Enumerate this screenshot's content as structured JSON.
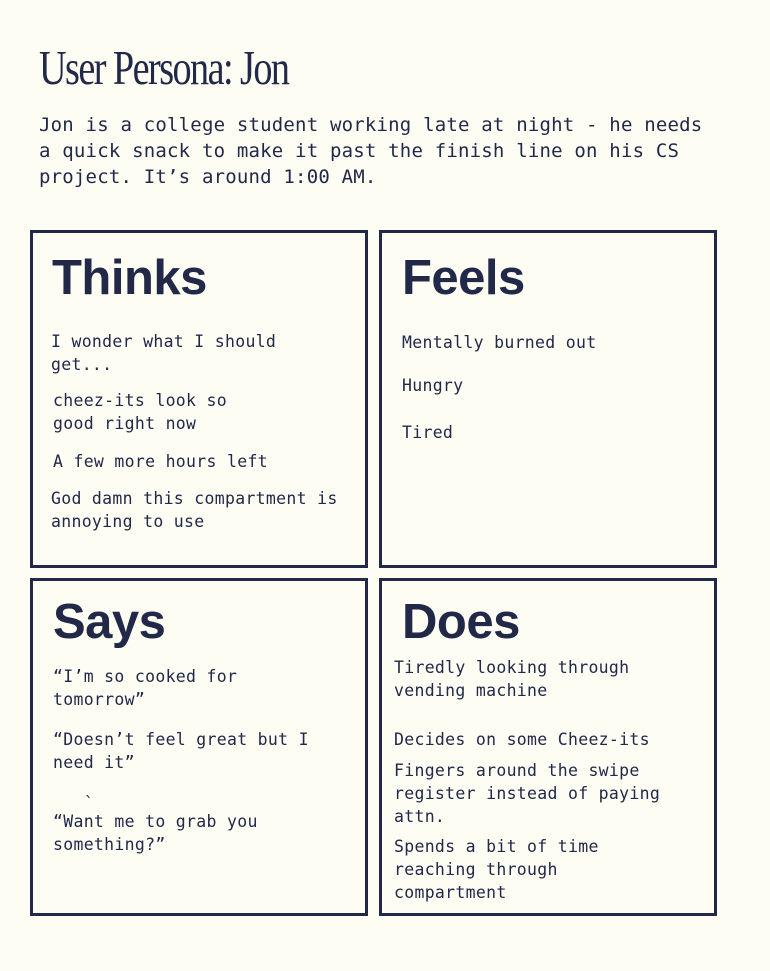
{
  "title": "User Persona: Jon",
  "intro": "Jon is a college student working late at night - he needs a quick snack to make it past the finish line on his CS project. It’s around 1:00 AM.",
  "quadrants": {
    "thinks": {
      "heading": "Thinks",
      "items": [
        "I wonder what I should get...",
        "cheez-its look so good right now",
        "A few more hours left",
        "God damn this compartment is annoying to use"
      ]
    },
    "feels": {
      "heading": "Feels",
      "items": [
        "Mentally burned out",
        "Hungry",
        "Tired"
      ]
    },
    "says": {
      "heading": "Says",
      "stray_mark": "`",
      "items": [
        "“I’m so cooked for tomorrow”",
        "“Doesn’t feel great but I need it”",
        "“Want me to grab you something?”"
      ]
    },
    "does": {
      "heading": "Does",
      "items": [
        "Tiredly looking through vending machine",
        "Decides on some Cheez-its",
        "Fingers around the swipe register instead of paying attn.",
        "Spends a bit of time reaching through compartment"
      ]
    }
  }
}
